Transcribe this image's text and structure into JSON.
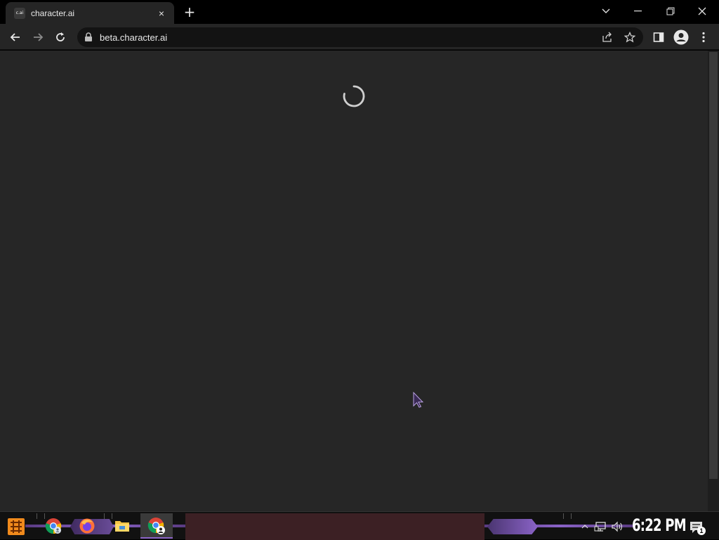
{
  "browser": {
    "tab": {
      "favicon_text": "c.ai",
      "title": "character.ai",
      "close_glyph": "×"
    },
    "new_tab_glyph": "+",
    "window_controls": [
      "tab-search",
      "minimize",
      "restore",
      "close"
    ],
    "address_bar": {
      "url": "beta.character.ai"
    },
    "toolbar_icons": [
      "back-icon",
      "forward-icon",
      "reload-icon",
      "lock-icon",
      "share-icon",
      "star-icon",
      "side-panel-icon",
      "profile-icon",
      "menu-icon"
    ]
  },
  "page": {
    "state": "loading",
    "background_color": "#262626",
    "spinner_color": "#cfcfcf"
  },
  "taskbar": {
    "pinned": [
      "start-button",
      "chrome-icon",
      "firefox-icon",
      "file-explorer-icon",
      "chrome-profile-icon"
    ],
    "tray": {
      "clock": "6:22 PM",
      "notification_count": "1",
      "tray_icons": [
        "show-hidden-icon",
        "network-icon",
        "volume-icon"
      ]
    },
    "accent_color": "#8a63c7"
  }
}
